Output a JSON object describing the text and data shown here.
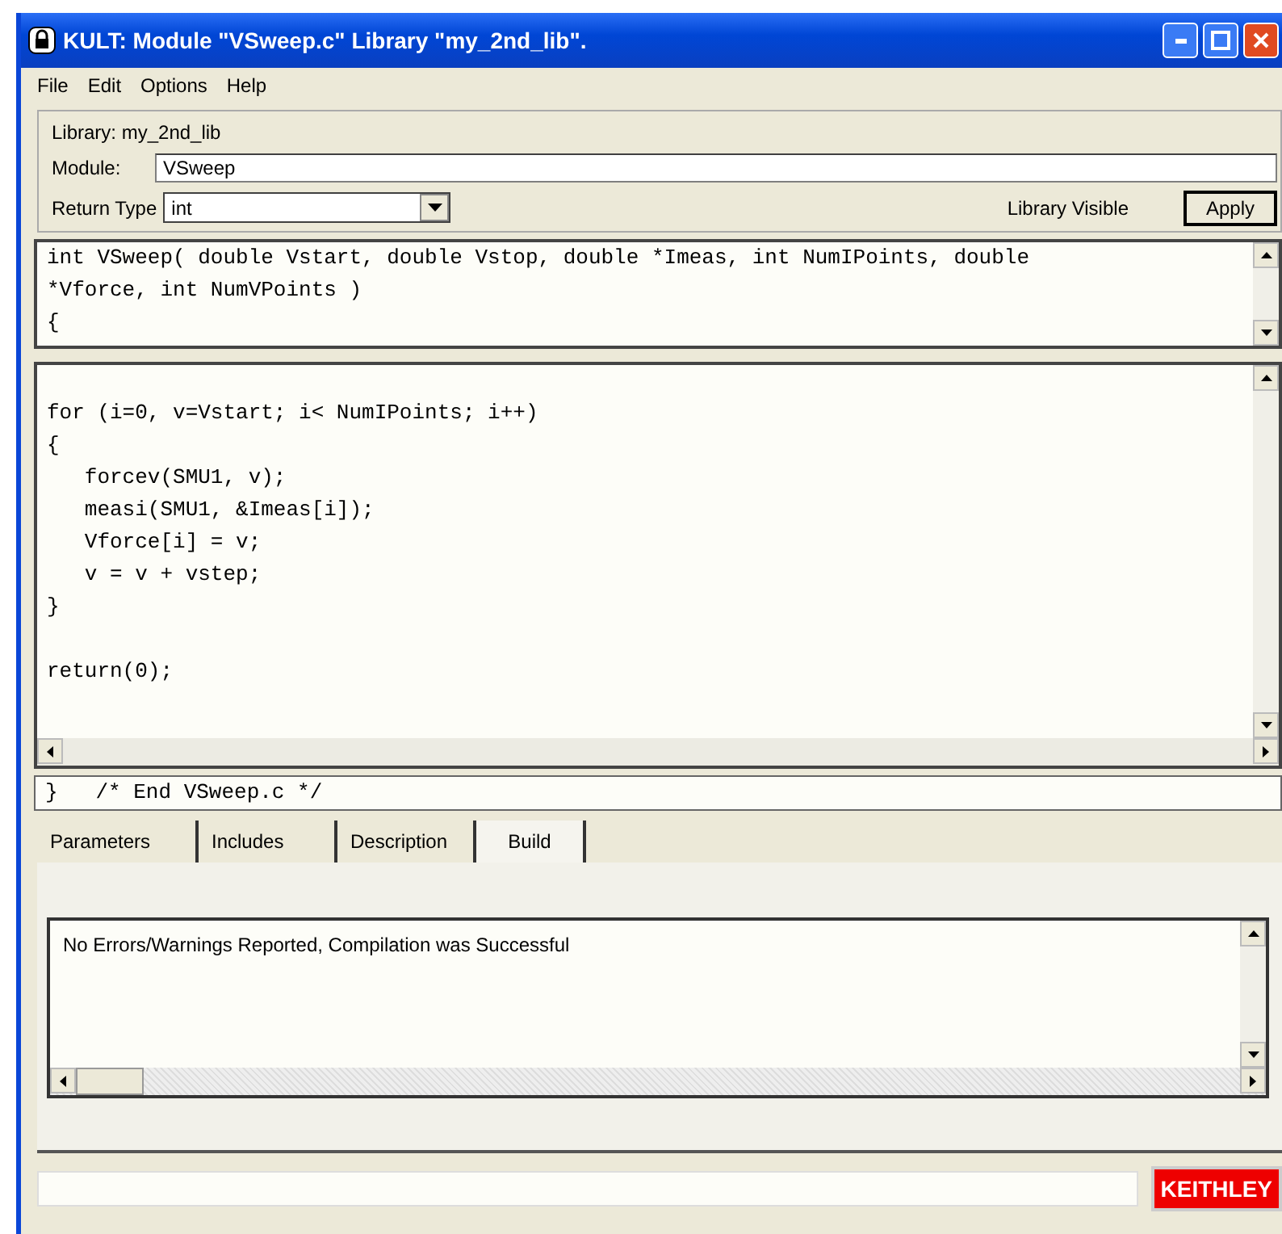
{
  "window": {
    "title": "KULT: Module \"VSweep.c\" Library \"my_2nd_lib\"."
  },
  "menu": [
    "File",
    "Edit",
    "Options",
    "Help"
  ],
  "library_label": "Library: my_2nd_lib",
  "module": {
    "label": "Module:",
    "value": "VSweep"
  },
  "return_type": {
    "label": "Return Type",
    "value": "int"
  },
  "library_visible": "Library Visible",
  "apply_button": "Apply",
  "header_code": "int VSweep( double Vstart, double Vstop, double *Imeas, int NumIPoints, double\n*Vforce, int NumVPoints )\n{",
  "body_code": "for (i=0, v=Vstart; i< NumIPoints; i++)\n{\n   forcev(SMU1, v);\n   measi(SMU1, &Imeas[i]);\n   Vforce[i] = v;\n   v = v + vstep;\n}\n\nreturn(0);",
  "footer_code": "}   /* End VSweep.c */",
  "tabs": [
    {
      "label": "Parameters",
      "selected": false
    },
    {
      "label": "Includes",
      "selected": false
    },
    {
      "label": "Description",
      "selected": false
    },
    {
      "label": "Build",
      "selected": true
    }
  ],
  "build_output": "No Errors/Warnings Reported, Compilation was Successful",
  "status_bar": {
    "logo": "KEITHLEY"
  }
}
